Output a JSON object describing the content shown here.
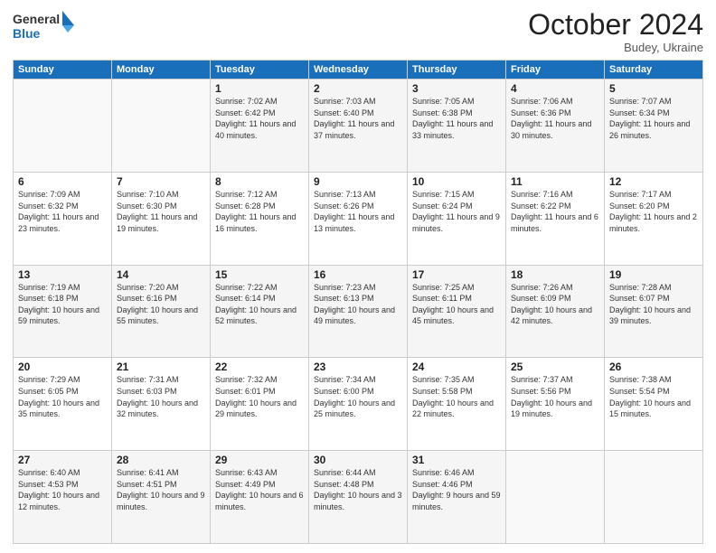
{
  "logo": {
    "line1": "General",
    "line2": "Blue"
  },
  "title": "October 2024",
  "subtitle": "Budey, Ukraine",
  "days_header": [
    "Sunday",
    "Monday",
    "Tuesday",
    "Wednesday",
    "Thursday",
    "Friday",
    "Saturday"
  ],
  "weeks": [
    [
      {
        "day": "",
        "info": ""
      },
      {
        "day": "",
        "info": ""
      },
      {
        "day": "1",
        "info": "Sunrise: 7:02 AM\nSunset: 6:42 PM\nDaylight: 11 hours and 40 minutes."
      },
      {
        "day": "2",
        "info": "Sunrise: 7:03 AM\nSunset: 6:40 PM\nDaylight: 11 hours and 37 minutes."
      },
      {
        "day": "3",
        "info": "Sunrise: 7:05 AM\nSunset: 6:38 PM\nDaylight: 11 hours and 33 minutes."
      },
      {
        "day": "4",
        "info": "Sunrise: 7:06 AM\nSunset: 6:36 PM\nDaylight: 11 hours and 30 minutes."
      },
      {
        "day": "5",
        "info": "Sunrise: 7:07 AM\nSunset: 6:34 PM\nDaylight: 11 hours and 26 minutes."
      }
    ],
    [
      {
        "day": "6",
        "info": "Sunrise: 7:09 AM\nSunset: 6:32 PM\nDaylight: 11 hours and 23 minutes."
      },
      {
        "day": "7",
        "info": "Sunrise: 7:10 AM\nSunset: 6:30 PM\nDaylight: 11 hours and 19 minutes."
      },
      {
        "day": "8",
        "info": "Sunrise: 7:12 AM\nSunset: 6:28 PM\nDaylight: 11 hours and 16 minutes."
      },
      {
        "day": "9",
        "info": "Sunrise: 7:13 AM\nSunset: 6:26 PM\nDaylight: 11 hours and 13 minutes."
      },
      {
        "day": "10",
        "info": "Sunrise: 7:15 AM\nSunset: 6:24 PM\nDaylight: 11 hours and 9 minutes."
      },
      {
        "day": "11",
        "info": "Sunrise: 7:16 AM\nSunset: 6:22 PM\nDaylight: 11 hours and 6 minutes."
      },
      {
        "day": "12",
        "info": "Sunrise: 7:17 AM\nSunset: 6:20 PM\nDaylight: 11 hours and 2 minutes."
      }
    ],
    [
      {
        "day": "13",
        "info": "Sunrise: 7:19 AM\nSunset: 6:18 PM\nDaylight: 10 hours and 59 minutes."
      },
      {
        "day": "14",
        "info": "Sunrise: 7:20 AM\nSunset: 6:16 PM\nDaylight: 10 hours and 55 minutes."
      },
      {
        "day": "15",
        "info": "Sunrise: 7:22 AM\nSunset: 6:14 PM\nDaylight: 10 hours and 52 minutes."
      },
      {
        "day": "16",
        "info": "Sunrise: 7:23 AM\nSunset: 6:13 PM\nDaylight: 10 hours and 49 minutes."
      },
      {
        "day": "17",
        "info": "Sunrise: 7:25 AM\nSunset: 6:11 PM\nDaylight: 10 hours and 45 minutes."
      },
      {
        "day": "18",
        "info": "Sunrise: 7:26 AM\nSunset: 6:09 PM\nDaylight: 10 hours and 42 minutes."
      },
      {
        "day": "19",
        "info": "Sunrise: 7:28 AM\nSunset: 6:07 PM\nDaylight: 10 hours and 39 minutes."
      }
    ],
    [
      {
        "day": "20",
        "info": "Sunrise: 7:29 AM\nSunset: 6:05 PM\nDaylight: 10 hours and 35 minutes."
      },
      {
        "day": "21",
        "info": "Sunrise: 7:31 AM\nSunset: 6:03 PM\nDaylight: 10 hours and 32 minutes."
      },
      {
        "day": "22",
        "info": "Sunrise: 7:32 AM\nSunset: 6:01 PM\nDaylight: 10 hours and 29 minutes."
      },
      {
        "day": "23",
        "info": "Sunrise: 7:34 AM\nSunset: 6:00 PM\nDaylight: 10 hours and 25 minutes."
      },
      {
        "day": "24",
        "info": "Sunrise: 7:35 AM\nSunset: 5:58 PM\nDaylight: 10 hours and 22 minutes."
      },
      {
        "day": "25",
        "info": "Sunrise: 7:37 AM\nSunset: 5:56 PM\nDaylight: 10 hours and 19 minutes."
      },
      {
        "day": "26",
        "info": "Sunrise: 7:38 AM\nSunset: 5:54 PM\nDaylight: 10 hours and 15 minutes."
      }
    ],
    [
      {
        "day": "27",
        "info": "Sunrise: 6:40 AM\nSunset: 4:53 PM\nDaylight: 10 hours and 12 minutes."
      },
      {
        "day": "28",
        "info": "Sunrise: 6:41 AM\nSunset: 4:51 PM\nDaylight: 10 hours and 9 minutes."
      },
      {
        "day": "29",
        "info": "Sunrise: 6:43 AM\nSunset: 4:49 PM\nDaylight: 10 hours and 6 minutes."
      },
      {
        "day": "30",
        "info": "Sunrise: 6:44 AM\nSunset: 4:48 PM\nDaylight: 10 hours and 3 minutes."
      },
      {
        "day": "31",
        "info": "Sunrise: 6:46 AM\nSunset: 4:46 PM\nDaylight: 9 hours and 59 minutes."
      },
      {
        "day": "",
        "info": ""
      },
      {
        "day": "",
        "info": ""
      }
    ]
  ]
}
